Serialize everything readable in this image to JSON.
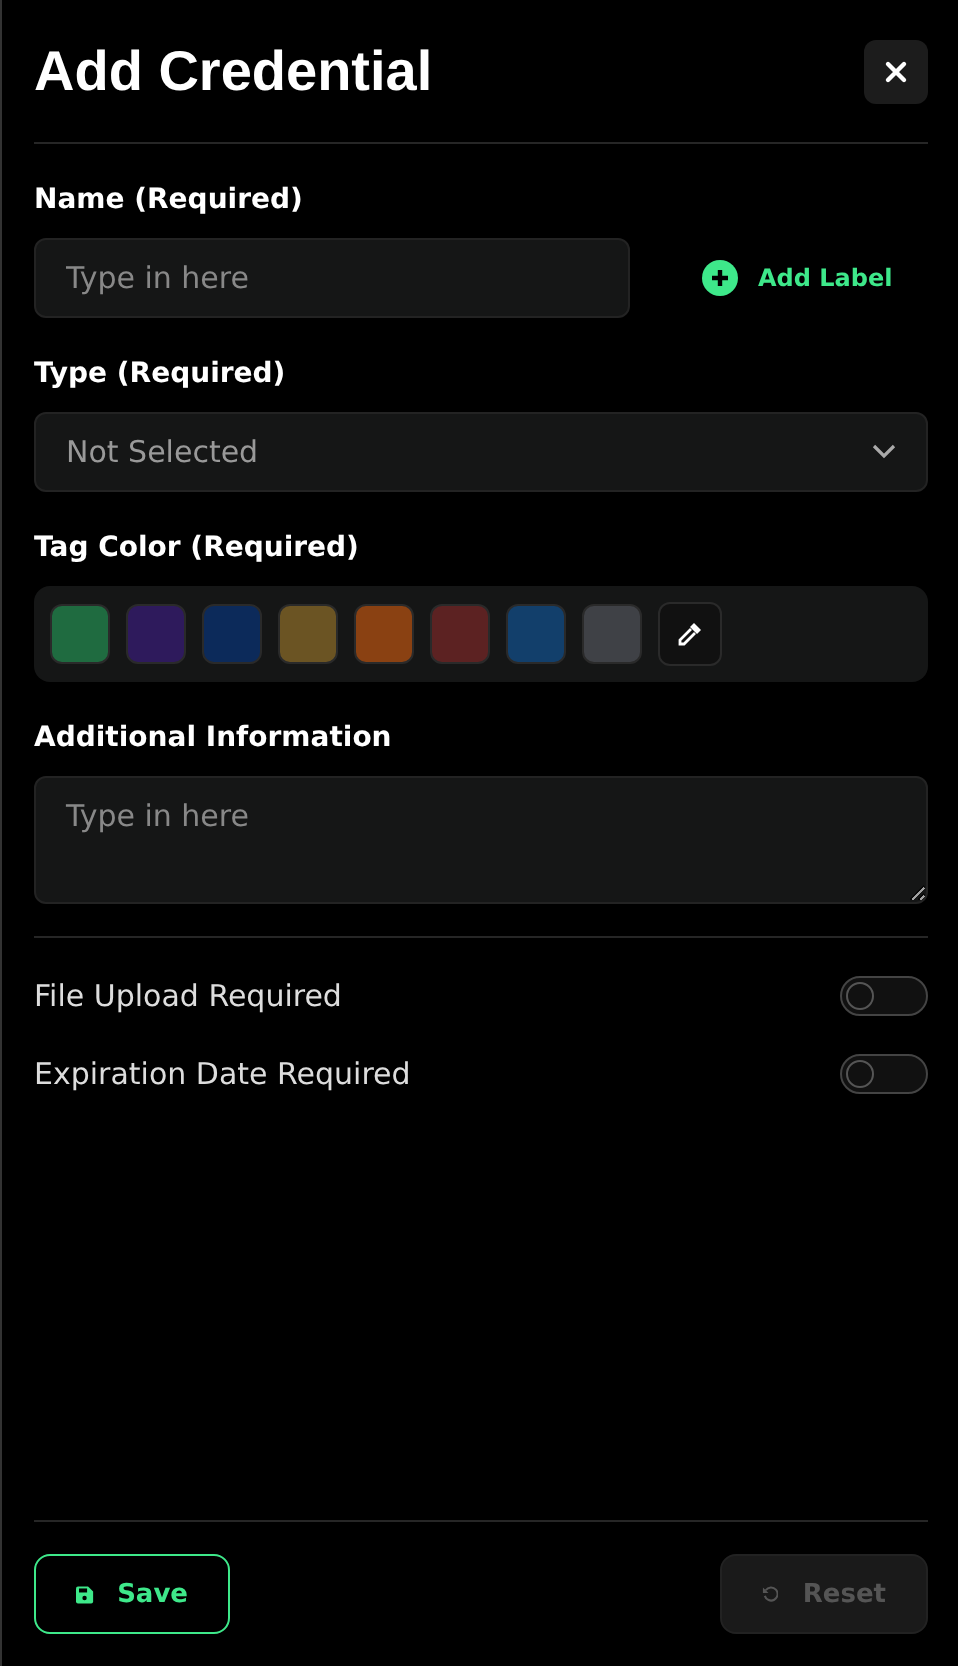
{
  "title": "Add Credential",
  "name_field": {
    "label": "Name (Required)",
    "placeholder": "Type in here"
  },
  "add_label": "Add Label",
  "type_field": {
    "label": "Type (Required)",
    "value": "Not Selected"
  },
  "tag_color": {
    "label": "Tag Color (Required)",
    "swatches": [
      {
        "color": "#1f6b40",
        "selected": false
      },
      {
        "color": "#2e1a5c",
        "selected": false
      },
      {
        "color": "#0c2a5a",
        "selected": false
      },
      {
        "color": "#6b5423",
        "selected": false
      },
      {
        "color": "#8a4112",
        "selected": false
      },
      {
        "color": "#5c2222",
        "selected": false
      },
      {
        "color": "#123f6b",
        "selected": false
      },
      {
        "color": "#3f4146",
        "selected": false
      }
    ]
  },
  "additional": {
    "label": "Additional Information",
    "placeholder": "Type in here"
  },
  "toggles": [
    {
      "label": "File Upload Required",
      "on": false
    },
    {
      "label": "Expiration Date Required",
      "on": false
    }
  ],
  "buttons": [
    {
      "kind": "save",
      "label": "Save",
      "disabled": false
    },
    {
      "kind": "reset",
      "label": "Reset",
      "disabled": true
    }
  ]
}
